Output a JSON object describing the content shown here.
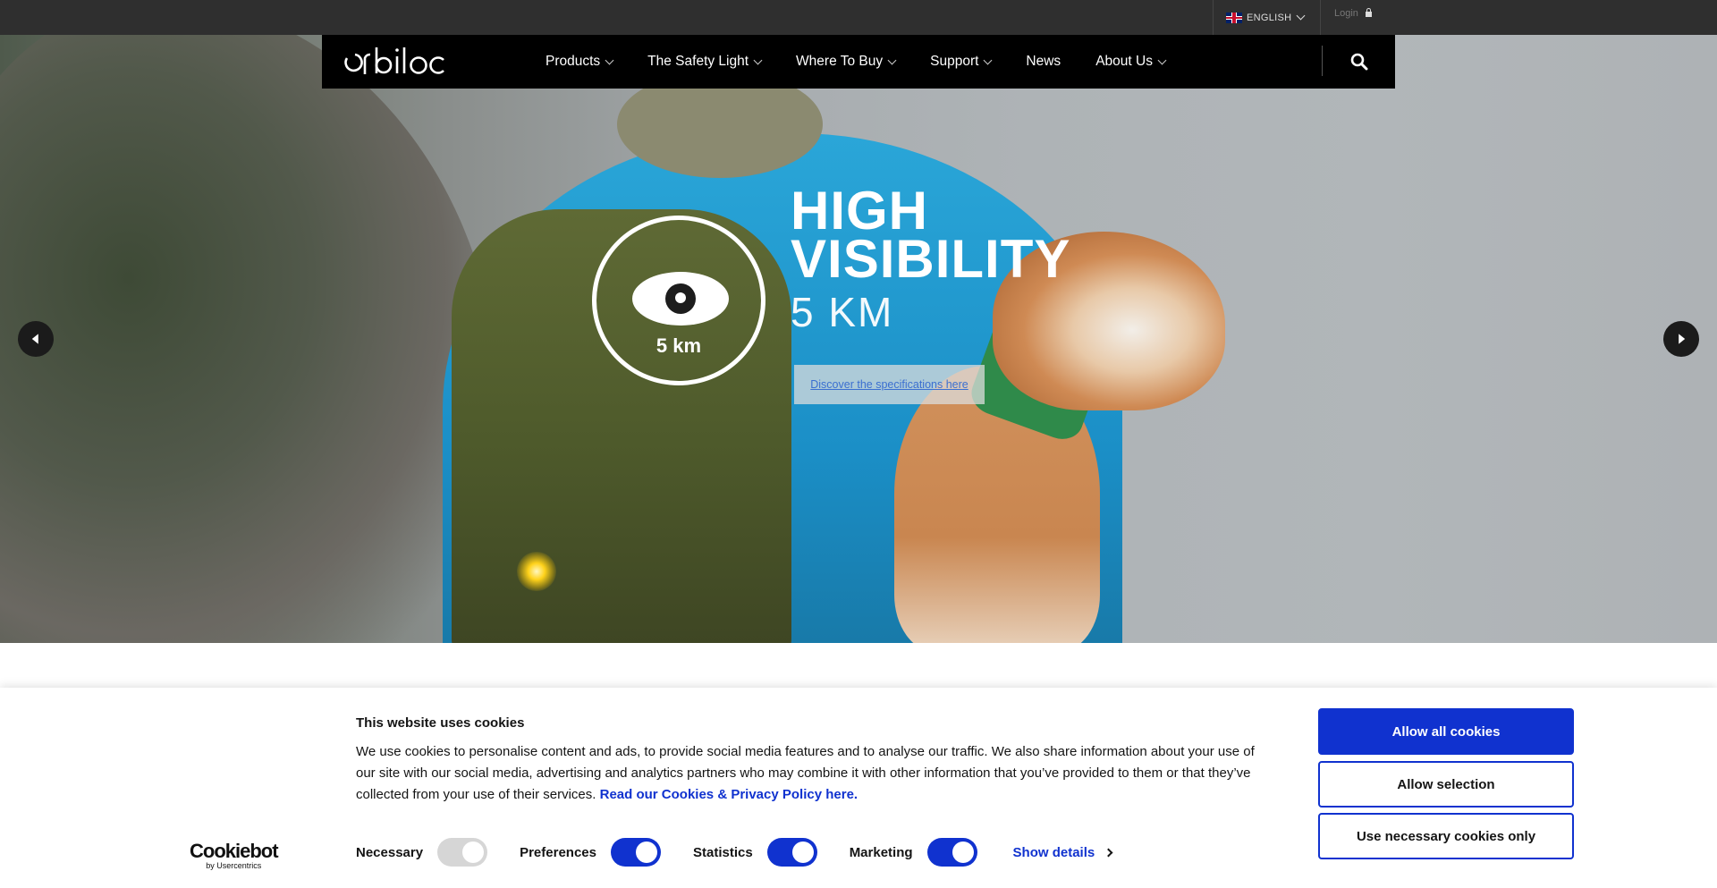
{
  "topbar": {
    "language": "ENGLISH",
    "login": "Login"
  },
  "nav": {
    "logo_text": "orbiloc",
    "items": [
      {
        "label": "Products",
        "has_dropdown": true
      },
      {
        "label": "The Safety Light",
        "has_dropdown": true
      },
      {
        "label": "Where To Buy",
        "has_dropdown": true
      },
      {
        "label": "Support",
        "has_dropdown": true
      },
      {
        "label": "News",
        "has_dropdown": false
      },
      {
        "label": "About Us",
        "has_dropdown": true
      }
    ],
    "search_icon": "search-icon"
  },
  "hero": {
    "badge_text": "5 km",
    "headline_line1": "HIGH",
    "headline_line2": "VISIBILITY",
    "subheadline": "5 KM",
    "cta_label": "Discover the specifications here"
  },
  "cookie_banner": {
    "title": "This website uses cookies",
    "body": "We use cookies to personalise content and ads, to provide social media features and to analyse our traffic. We also share information about your use of our site with our social media, advertising and analytics partners who may combine it with other information that you’ve provided to them or that they’ve collected from your use of their services.",
    "policy_link": "Read our Cookies & Privacy Policy here.",
    "logo_main": "Cookiebot",
    "logo_sub": "by Usercentrics",
    "toggles": [
      {
        "label": "Necessary",
        "state": "on-disabled"
      },
      {
        "label": "Preferences",
        "state": "on"
      },
      {
        "label": "Statistics",
        "state": "on"
      },
      {
        "label": "Marketing",
        "state": "on"
      }
    ],
    "show_details": "Show details",
    "buttons": {
      "allow_all": "Allow all cookies",
      "allow_selection": "Allow selection",
      "necessary_only": "Use necessary cookies only"
    }
  },
  "colors": {
    "primary_blue": "#1032cf",
    "nav_bg": "#000000",
    "topbar_bg": "#2f2f2f"
  }
}
